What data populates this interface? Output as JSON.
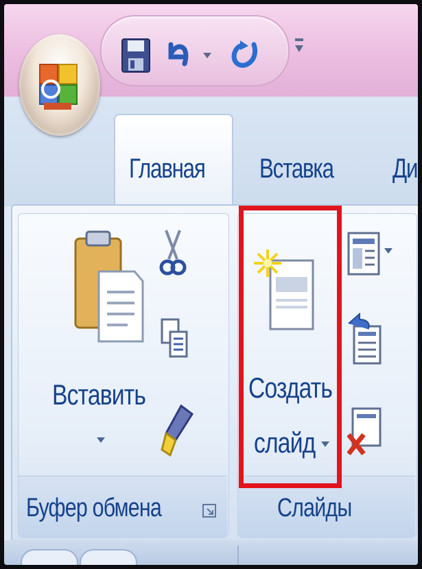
{
  "tabs": {
    "home": "Главная",
    "insert": "Вставка",
    "design_partial": "Ди"
  },
  "clipboard": {
    "paste_label": "Вставить",
    "group_label": "Буфер обмена"
  },
  "slides": {
    "new_slide_line1": "Создать",
    "new_slide_line2": "слайд",
    "group_label": "Слайды"
  },
  "colors": {
    "highlight": "#e1141c",
    "text_accent": "#15428b"
  },
  "icons": {
    "qat": [
      "save-icon",
      "undo-icon",
      "redo-icon",
      "customize-qat-icon"
    ],
    "clipboard": [
      "paste-icon",
      "cut-icon",
      "copy-icon",
      "format-painter-icon",
      "dialog-launcher-icon"
    ],
    "slides": [
      "new-slide-icon",
      "layout-icon",
      "reset-icon",
      "delete-slide-icon"
    ]
  }
}
